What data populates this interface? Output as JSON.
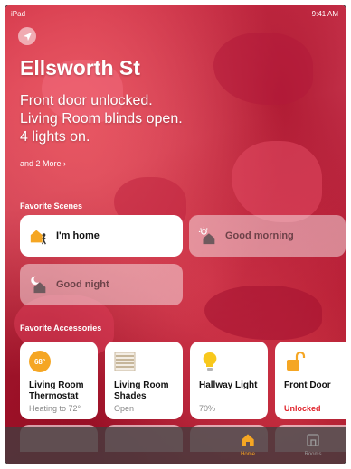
{
  "status_bar": {
    "carrier": "iPad",
    "time": "9:41 AM"
  },
  "home": {
    "title": "Ellsworth St",
    "summary": [
      "Front door unlocked.",
      "Living Room blinds open.",
      "4 lights on."
    ],
    "more_link": "and 2 More ›"
  },
  "scenes": {
    "section_label": "Favorite Scenes",
    "items": [
      {
        "label": "I'm home",
        "icon": "house-person-icon",
        "active": true
      },
      {
        "label": "Good morning",
        "icon": "house-sun-icon",
        "active": false
      },
      {
        "label": "Good night",
        "icon": "house-moon-icon",
        "active": false
      }
    ]
  },
  "accessories": {
    "section_label": "Favorite Accessories",
    "items": [
      {
        "name": "Living Room Thermostat",
        "status": "Heating to 72°",
        "badge": "68°",
        "icon": "thermostat-icon"
      },
      {
        "name": "Living Room Shades",
        "status": "Open",
        "icon": "shades-icon"
      },
      {
        "name": "Hallway Light",
        "status": "70%",
        "icon": "lightbulb-icon"
      },
      {
        "name": "Front Door",
        "status": "Unlocked",
        "icon": "lock-open-icon",
        "status_color": "#e0232b"
      }
    ]
  },
  "tab_bar": {
    "tabs": [
      {
        "label": "Home",
        "selected": true,
        "color": "#f5a623"
      },
      {
        "label": "Rooms",
        "selected": false,
        "color": "#9a9a9a"
      }
    ]
  }
}
